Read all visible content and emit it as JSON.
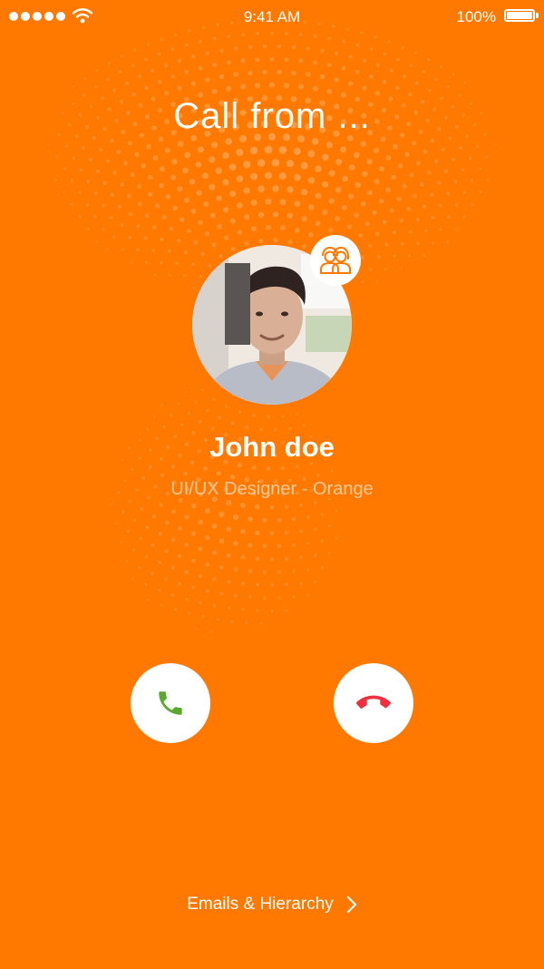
{
  "status_bar": {
    "signal_icon": "signal-dots-icon",
    "wifi_icon": "wifi-icon",
    "time": "9:41 AM",
    "battery_percent": "100%",
    "battery_icon": "battery-icon"
  },
  "call": {
    "title": "Call from ...",
    "caller_name": "John doe",
    "caller_role": "UI/UX Designer - Orange",
    "contact_badge_icon": "contacts-icon",
    "accept_icon": "phone-accept-icon",
    "decline_icon": "phone-decline-icon"
  },
  "footer": {
    "link_label": "Emails & Hierarchy",
    "link_icon": "chevron-right-icon"
  },
  "colors": {
    "background": "#ff7900",
    "accept_green": "#5ba82f",
    "decline_red": "#f0303e",
    "role_text": "#ffc999"
  }
}
